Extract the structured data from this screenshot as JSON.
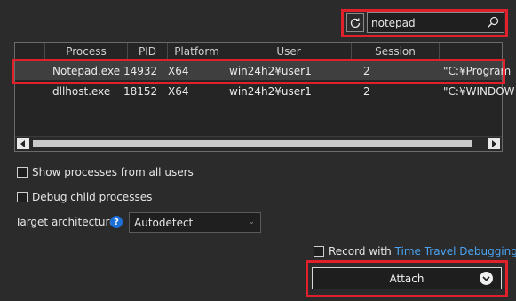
{
  "search": {
    "value": "notepad",
    "refresh_icon": "refresh-icon",
    "search_icon": "search-icon"
  },
  "table": {
    "columns": [
      "Process",
      "PID",
      "Platform",
      "User",
      "Session"
    ],
    "rows": [
      {
        "process": "Notepad.exe",
        "pid": "14932",
        "platform": "X64",
        "user": "win24h2¥user1",
        "session": "2",
        "command": "\"C:¥Program"
      },
      {
        "process": "dllhost.exe",
        "pid": "18152",
        "platform": "X64",
        "user": "win24h2¥user1",
        "session": "2",
        "command": "\"C:¥WINDOW"
      }
    ],
    "selected_row": 0
  },
  "options": {
    "show_all_users": {
      "label": "Show processes from all users",
      "checked": false
    },
    "debug_child": {
      "label": "Debug child processes",
      "checked": false
    },
    "target_arch": {
      "label": "Target architecture:",
      "help": "?",
      "value": "Autodetect"
    },
    "record": {
      "prefix": "Record with ",
      "link": "Time Travel Debugging",
      "checked": false
    }
  },
  "attach": {
    "label": "Attach"
  },
  "colors": {
    "highlight": "#e0202a",
    "link": "#4aa3f0",
    "help": "#1d6fd6"
  }
}
